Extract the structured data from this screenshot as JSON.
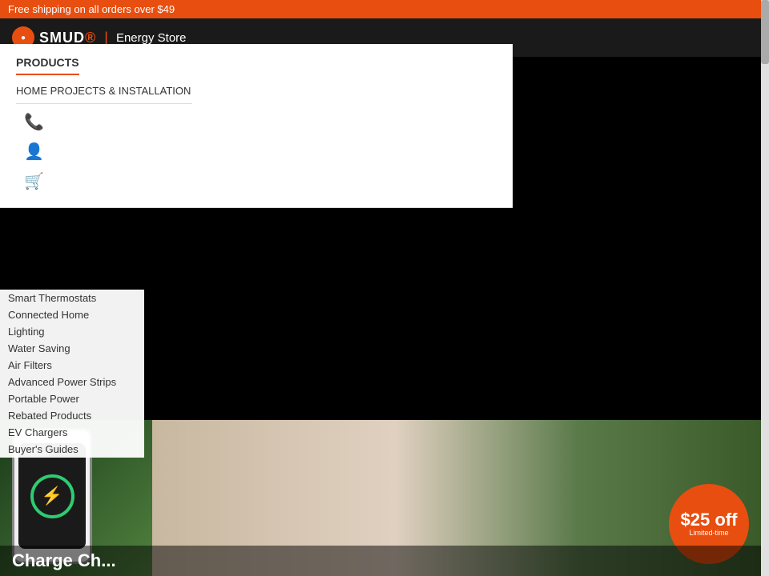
{
  "banner": {
    "text": "Free shipping on all orders over $49"
  },
  "header": {
    "logo_smud": "SMUD",
    "logo_separator": "|",
    "logo_store": "Energy Store"
  },
  "nav": {
    "products_label": "PRODUCTS",
    "home_projects_label": "HOME PROJECTS & INSTALLATION",
    "menu_items": [
      {
        "label": "Smart Thermostats",
        "href": "#"
      },
      {
        "label": "Connected Home",
        "href": "#"
      },
      {
        "label": "Lighting",
        "href": "#"
      },
      {
        "label": "Water Saving",
        "href": "#"
      },
      {
        "label": "Air Filters",
        "href": "#"
      },
      {
        "label": "Advanced Power Strips",
        "href": "#"
      },
      {
        "label": "Portable Power",
        "href": "#"
      },
      {
        "label": "Rebated Products",
        "href": "#"
      },
      {
        "label": "EV Chargers",
        "href": "#"
      },
      {
        "label": "Buyer's Guides",
        "href": "#"
      }
    ]
  },
  "hero": {
    "promo_amount": "$25 off",
    "promo_label": "Limited-time",
    "title_start": "Charge"
  },
  "icons": {
    "phone": "📞",
    "user": "👤",
    "cart": "🛒",
    "bolt": "⚡"
  }
}
